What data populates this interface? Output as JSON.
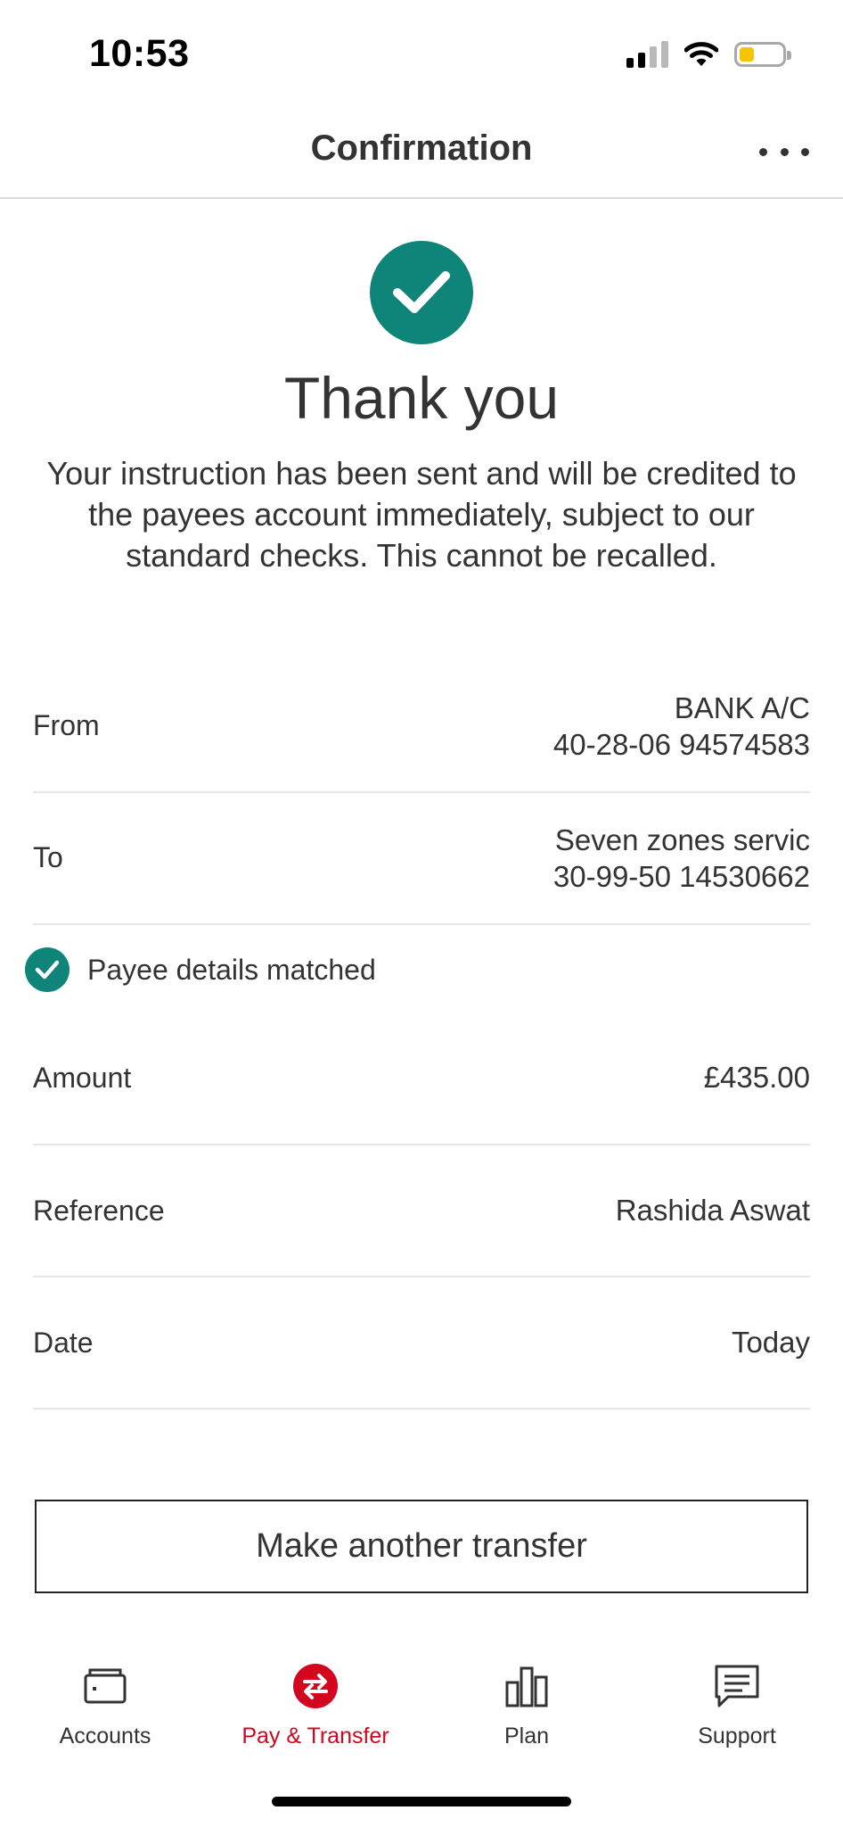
{
  "status_bar": {
    "time": "10:53",
    "icons": [
      "signal-icon",
      "wifi-icon",
      "battery-icon"
    ],
    "battery_color": "#f5c400"
  },
  "header": {
    "title": "Confirmation",
    "more_icon": "more-options-icon"
  },
  "confirmation": {
    "icon": "checkmark-icon",
    "heading": "Thank you",
    "message": "Your instruction has been sent and will be credited to the payees account immediately, subject to our standard checks.  This cannot be recalled."
  },
  "details": {
    "from": {
      "label": "From",
      "value_line1": "BANK A/C",
      "value_line2": "40-28-06 94574583"
    },
    "to": {
      "label": "To",
      "value_line1": "Seven zones servic",
      "value_line2": "30-99-50 14530662"
    },
    "payee_match": {
      "icon": "check-circle-icon",
      "label": "Payee details matched"
    },
    "amount": {
      "label": "Amount",
      "value": "£435.00"
    },
    "reference": {
      "label": "Reference",
      "value": "Rashida Aswat"
    },
    "date": {
      "label": "Date",
      "value": "Today"
    }
  },
  "actions": {
    "make_another_transfer": "Make another transfer"
  },
  "tab_bar": {
    "items": [
      {
        "label": "Accounts",
        "icon": "wallet-icon",
        "active": false
      },
      {
        "label": "Pay & Transfer",
        "icon": "transfer-arrows-icon",
        "active": true
      },
      {
        "label": "Plan",
        "icon": "bar-chart-icon",
        "active": false
      },
      {
        "label": "Support",
        "icon": "chat-bubble-icon",
        "active": false
      }
    ]
  },
  "colors": {
    "accent_teal": "#0f8478",
    "active_red": "#d3051f",
    "text": "#333333",
    "divider": "#e6e6e6"
  }
}
